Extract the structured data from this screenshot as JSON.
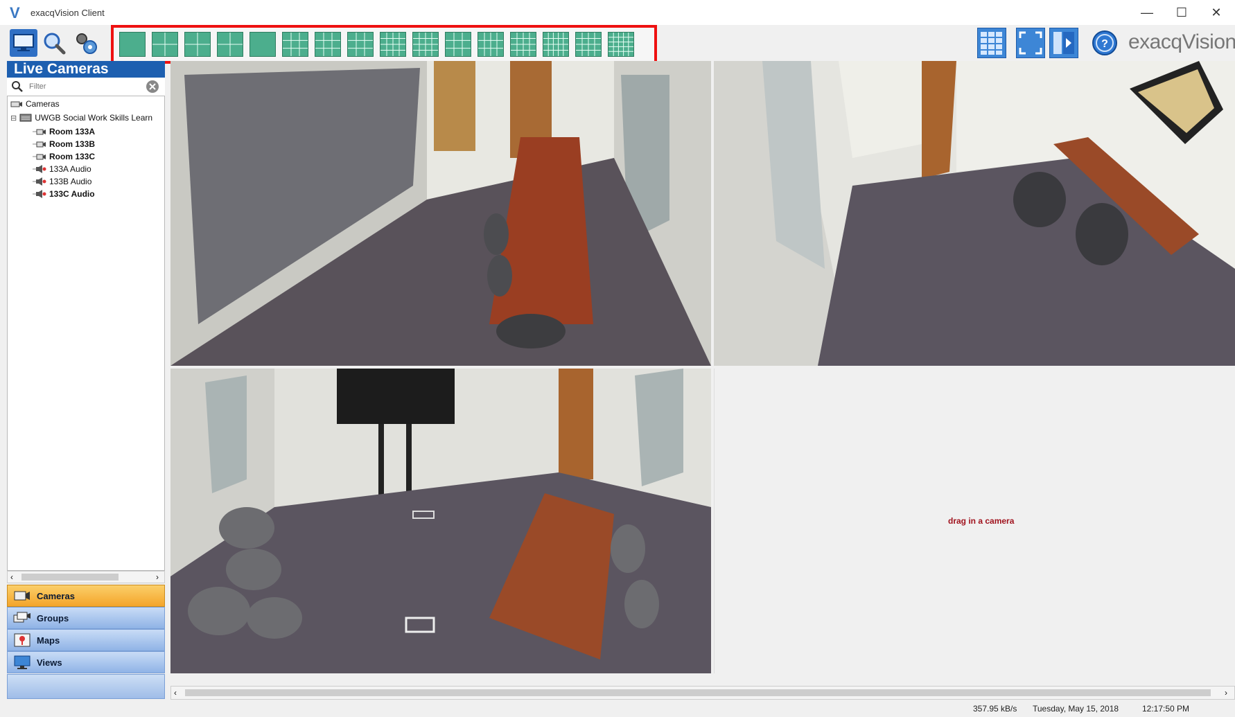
{
  "window": {
    "title": "exacqVision Client",
    "logo_letter": "V",
    "controls": {
      "minimize": "—",
      "maximize": "☐",
      "close": "✕"
    }
  },
  "toolbar": {
    "left_icons": [
      "live-monitor-icon",
      "search-icon",
      "config-gear-icon"
    ],
    "layout_count": 16,
    "right_icons": [
      "multi-grid-icon",
      "fullscreen-icon",
      "sequence-icon",
      "help-icon"
    ],
    "brand": "exacqVision",
    "layout_strip_highlight": "#ee1111"
  },
  "left_panel": {
    "header": "Live Cameras",
    "filter_placeholder": "Filter",
    "tree": {
      "root": "Cameras",
      "server": "UWGB Social Work Skills Learn",
      "items": [
        {
          "label": "Room 133A",
          "type": "camera",
          "bold": true
        },
        {
          "label": "Room 133B",
          "type": "camera",
          "bold": true
        },
        {
          "label": "Room 133C",
          "type": "camera",
          "bold": true
        },
        {
          "label": "133A Audio",
          "type": "audio",
          "bold": false
        },
        {
          "label": "133B Audio",
          "type": "audio",
          "bold": false
        },
        {
          "label": "133C Audio",
          "type": "audio",
          "bold": true
        }
      ]
    },
    "nav": [
      {
        "label": "Cameras",
        "active": true
      },
      {
        "label": "Groups",
        "active": false
      },
      {
        "label": "Maps",
        "active": false
      },
      {
        "label": "Views",
        "active": false
      }
    ]
  },
  "main": {
    "empty_tile_message": "drag in a camera"
  },
  "status": {
    "bandwidth": "357.95 kB/s",
    "date": "Tuesday, May 15, 2018",
    "time": "12:17:50 PM"
  },
  "colors": {
    "accent_blue": "#1d5fb0",
    "layout_green": "#4cae8d",
    "active_nav": "#f4a52a"
  }
}
